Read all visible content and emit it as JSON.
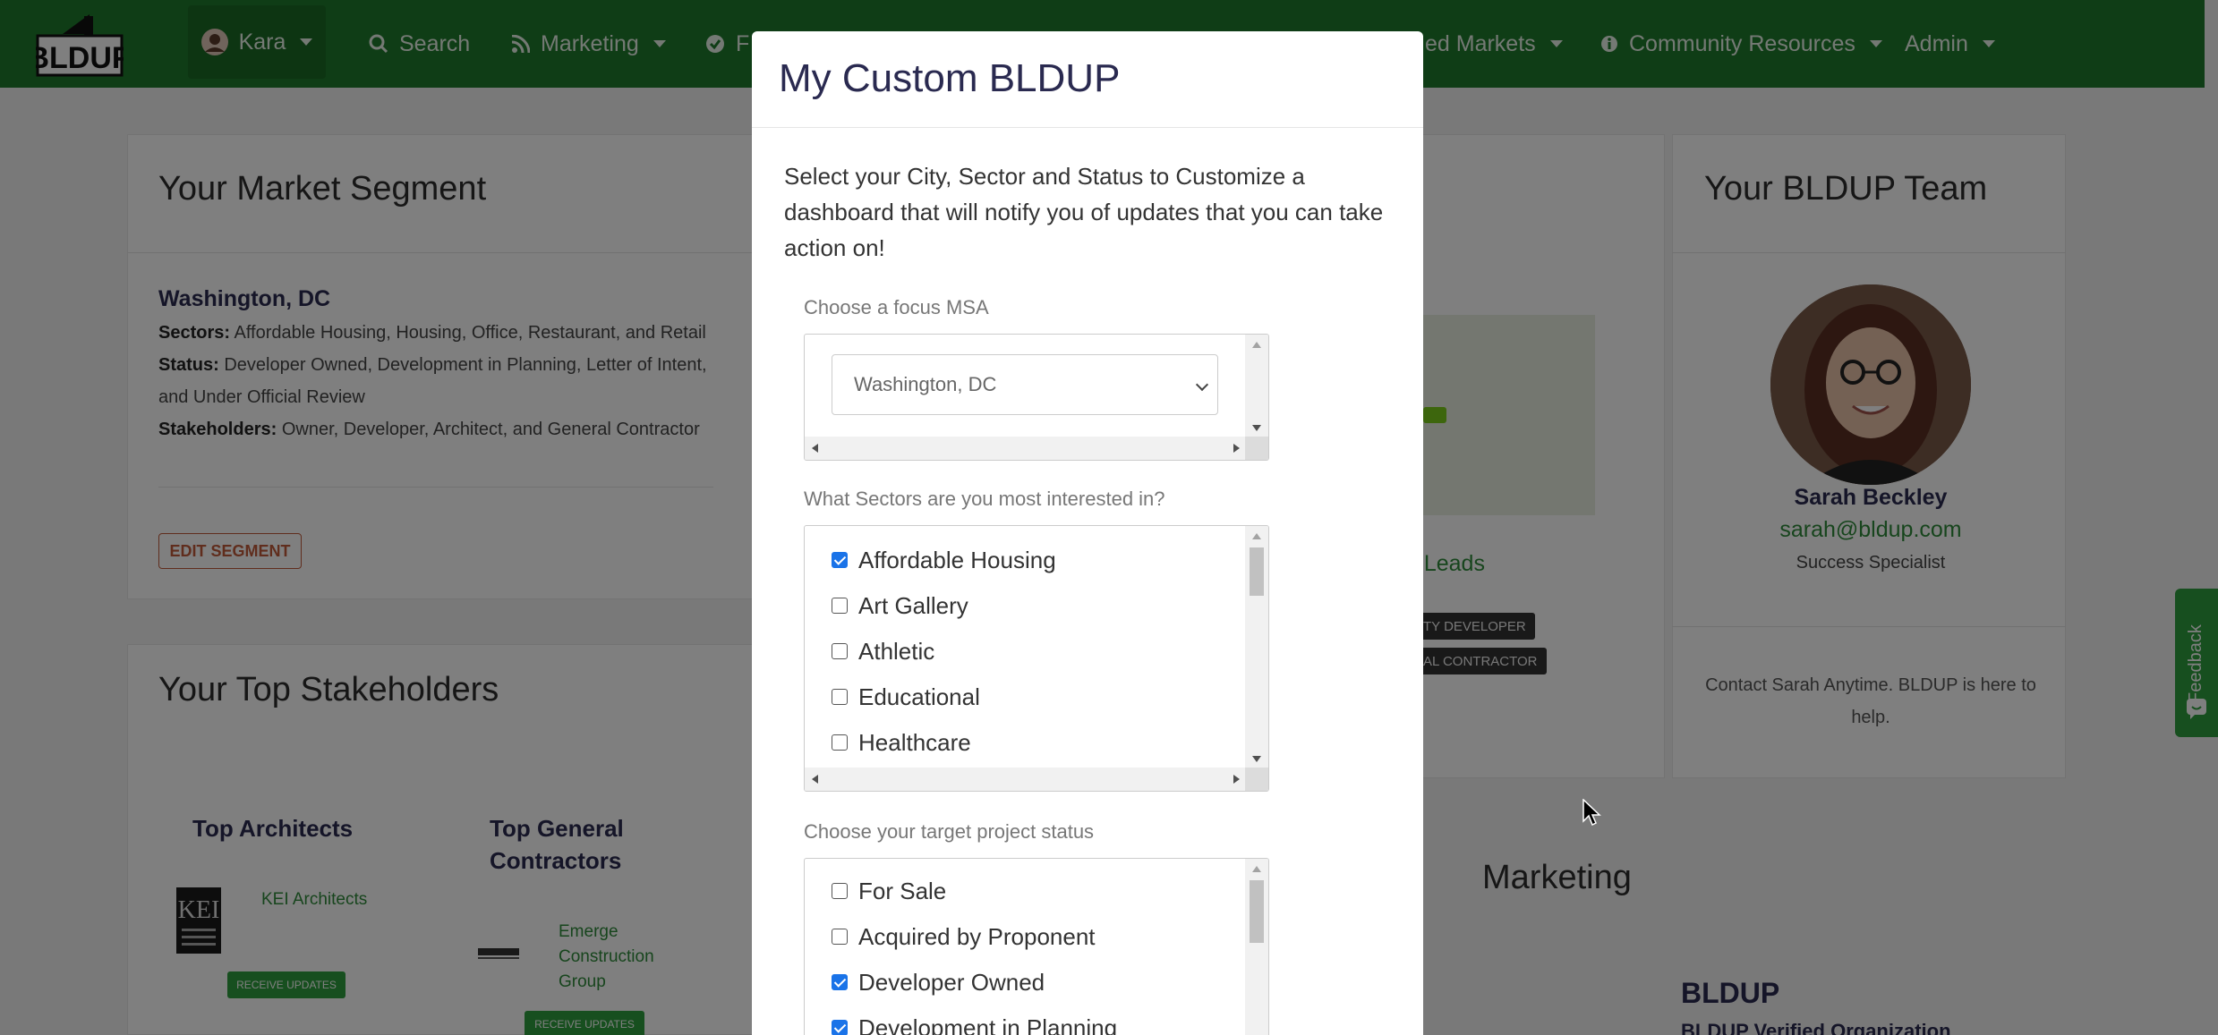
{
  "nav": {
    "logo_text": "BLDUP",
    "user": "Kara",
    "search": "Search",
    "marketing": "Marketing",
    "partial_item": "F",
    "markets": "ed Markets",
    "community": "Community Resources",
    "admin": "Admin"
  },
  "segment": {
    "title": "Your Market Segment",
    "location": "Washington, DC",
    "sectors_label": "Sectors:",
    "sectors": "Affordable Housing, Housing, Office, Restaurant, and Retail",
    "status_label": "Status:",
    "status_line1": "Developer Owned, Development in Planning, Letter of Intent,",
    "status_line2": "and Under Official Review",
    "stakeholders_label": "Stakeholders:",
    "stakeholders": "Owner, Developer, Architect, and General Contractor",
    "edit_button": "EDIT SEGMENT"
  },
  "stakeholders": {
    "title": "Your Top Stakeholders",
    "architects_head": "Top Architects",
    "gc_head_line1": "Top General",
    "gc_head_line2": "Contractors",
    "architect_name": "KEI Architects",
    "gc_name_line1": "Emerge",
    "gc_name_line2": "Construction",
    "gc_name_line3": "Group",
    "receive_updates": "RECEIVE UPDATES"
  },
  "middle": {
    "leads_partial": "e Leads",
    "tag1": "TY DEVELOPER",
    "tag2": "AL CONTRACTOR",
    "marketing_title": "Marketing",
    "bldup_title": "BLDUP",
    "verified": "BLDUP Verified Organization"
  },
  "team": {
    "title": "Your BLDUP Team",
    "name": "Sarah Beckley",
    "email": "sarah@bldup.com",
    "role": "Success Specialist",
    "note": "Contact Sarah Anytime. BLDUP is here to help."
  },
  "feedback": "Feedback",
  "modal": {
    "title": "My Custom BLDUP",
    "intro": "Select your City, Sector and Status to Customize a dashboard that will notify you of updates that you can take action on!",
    "msa_label": "Choose a focus MSA",
    "msa_value": "Washington, DC",
    "sectors_label": "What Sectors are you most interested in?",
    "sectors": [
      {
        "label": "Affordable Housing",
        "checked": true
      },
      {
        "label": "Art Gallery",
        "checked": false
      },
      {
        "label": "Athletic",
        "checked": false
      },
      {
        "label": "Educational",
        "checked": false
      },
      {
        "label": "Healthcare",
        "checked": false
      }
    ],
    "status_label": "Choose your target project status",
    "statuses": [
      {
        "label": "For Sale",
        "checked": false
      },
      {
        "label": "Acquired by Proponent",
        "checked": false
      },
      {
        "label": "Developer Owned",
        "checked": true
      },
      {
        "label": "Development in Planning",
        "checked": true
      }
    ]
  },
  "colors": {
    "nav_green": "#1f7a2c",
    "link_green": "#2e8b3a",
    "heading_navy": "#2a2a50",
    "checkbox_blue": "#1a73e8"
  }
}
